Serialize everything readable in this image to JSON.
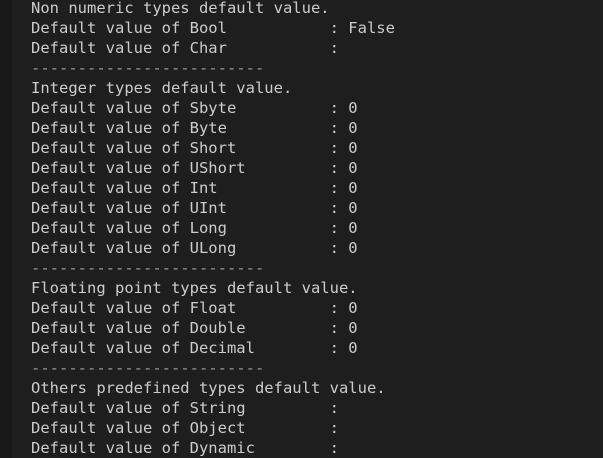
{
  "terminal": {
    "lines": [
      {
        "text": "Non numeric types default value.",
        "kind": "header"
      },
      {
        "text": "Default value of Bool           : False",
        "kind": "value"
      },
      {
        "text": "Default value of Char           :",
        "kind": "value"
      },
      {
        "text": "-------------------------",
        "kind": "separator"
      },
      {
        "text": "Integer types default value.",
        "kind": "header"
      },
      {
        "text": "Default value of Sbyte          : 0",
        "kind": "value"
      },
      {
        "text": "Default value of Byte           : 0",
        "kind": "value"
      },
      {
        "text": "Default value of Short          : 0",
        "kind": "value"
      },
      {
        "text": "Default value of UShort         : 0",
        "kind": "value"
      },
      {
        "text": "Default value of Int            : 0",
        "kind": "value"
      },
      {
        "text": "Default value of UInt           : 0",
        "kind": "value"
      },
      {
        "text": "Default value of Long           : 0",
        "kind": "value"
      },
      {
        "text": "Default value of ULong          : 0",
        "kind": "value"
      },
      {
        "text": "-------------------------",
        "kind": "separator"
      },
      {
        "text": "Floating point types default value.",
        "kind": "header"
      },
      {
        "text": "Default value of Float          : 0",
        "kind": "value"
      },
      {
        "text": "Default value of Double         : 0",
        "kind": "value"
      },
      {
        "text": "Default value of Decimal        : 0",
        "kind": "value"
      },
      {
        "text": "-------------------------",
        "kind": "separator"
      },
      {
        "text": "Others predefined types default value.",
        "kind": "header"
      },
      {
        "text": "Default value of String         :",
        "kind": "value"
      },
      {
        "text": "Default value of Object         :",
        "kind": "value"
      },
      {
        "text": "Default value of Dynamic        :",
        "kind": "value"
      }
    ]
  },
  "colors": {
    "background": "#1e1e1e",
    "text": "#cccccc",
    "separator": "#9a9a9a"
  }
}
